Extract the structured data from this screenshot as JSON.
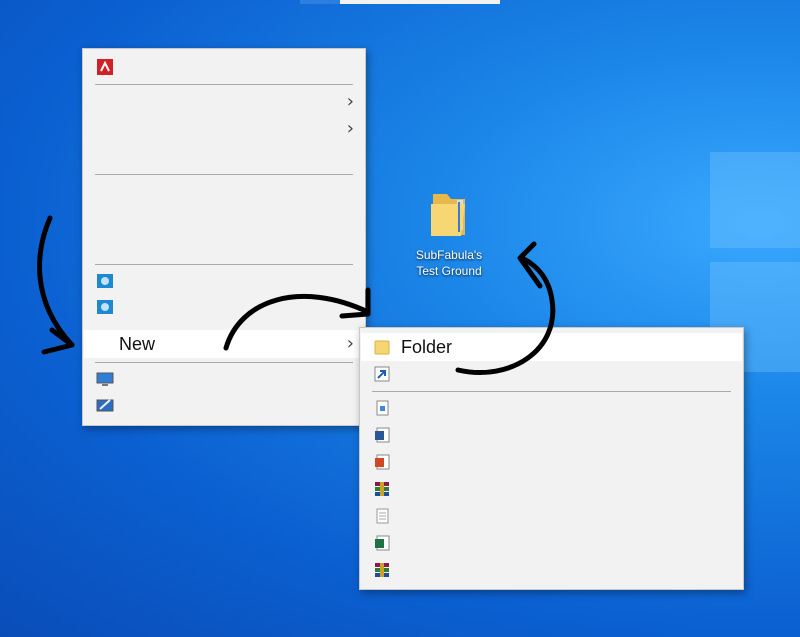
{
  "context_menu": {
    "new_label": "New"
  },
  "submenu": {
    "folder_label": "Folder"
  },
  "desktop": {
    "folder_name_line1": "SubFabula's",
    "folder_name_line2": "Test Ground"
  },
  "colors": {
    "menu_bg": "#f2f2f2",
    "highlight": "#ffffff",
    "desktop_blue": "#0b5fd0"
  }
}
